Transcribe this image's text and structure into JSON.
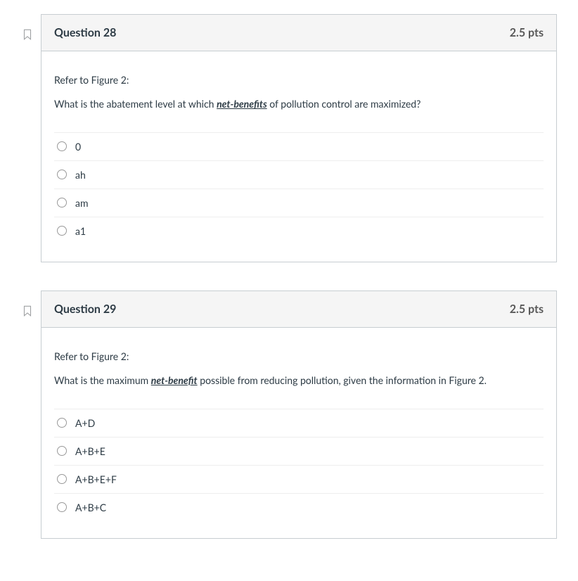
{
  "questions": [
    {
      "title": "Question 28",
      "pts": "2.5 pts",
      "prompt_line1": "Refer to Figure 2:",
      "prompt_before": "What is the abatement level at which ",
      "prompt_emph": "net-benefits",
      "prompt_after": " of pollution control are maximized?",
      "answers": [
        "0",
        "ah",
        "am",
        "a1"
      ]
    },
    {
      "title": "Question 29",
      "pts": "2.5 pts",
      "prompt_line1": "Refer to Figure 2:",
      "prompt_before": "What is the maximum ",
      "prompt_emph": "net-benefit",
      "prompt_after": " possible from reducing pollution, given the information in Figure 2.",
      "answers": [
        "A+D",
        "A+B+E",
        "A+B+E+F",
        "A+B+C"
      ]
    }
  ]
}
